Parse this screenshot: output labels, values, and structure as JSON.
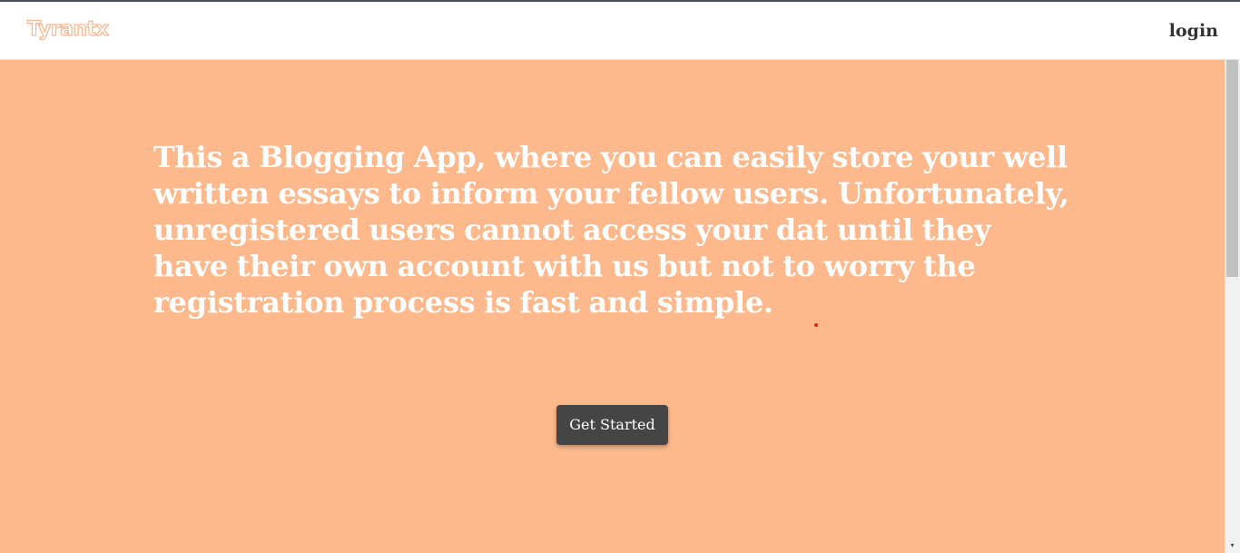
{
  "navbar": {
    "brand": "Tyrantx",
    "login_label": "login"
  },
  "hero": {
    "text": "This a Blogging App, where you can easily store your well written essays to inform your fellow users. Unfortunately, unregistered users cannot access your dat until they have their own account with us but not to worry the registration process is fast and simple.",
    "cta_label": "Get Started"
  },
  "scrollbar": {
    "down_arrow_icon": "▾"
  },
  "colors": {
    "hero_background": "#fdb88c",
    "brand_outline": "#f9b98d",
    "button_background": "#454545",
    "login_text": "#333333"
  }
}
